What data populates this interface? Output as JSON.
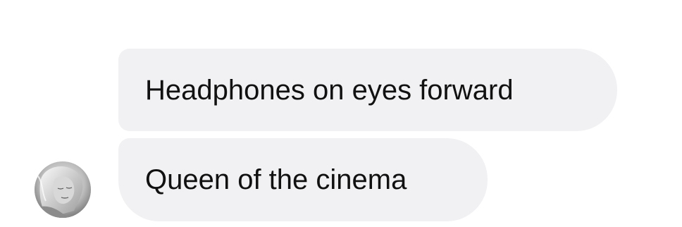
{
  "conversation": {
    "messages": [
      {
        "text": "Headphones on eyes forward"
      },
      {
        "text": "Queen of the cinema"
      }
    ]
  },
  "avatar": {
    "icon": "profile-photo-grayscale"
  },
  "colors": {
    "bubble_background": "#f1f1f3",
    "message_text": "#111111",
    "page_background": "#ffffff"
  }
}
